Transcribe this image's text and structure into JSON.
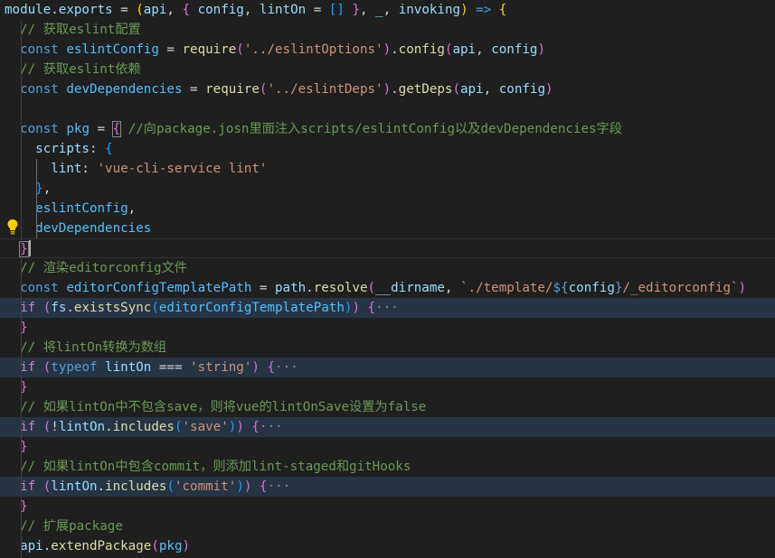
{
  "editor": {
    "lines": [
      {
        "id": "l1",
        "tokens": [
          {
            "t": "module",
            "k": "v"
          },
          {
            "t": ".",
            "k": "p"
          },
          {
            "t": "exports",
            "k": "v"
          },
          {
            "t": " = ",
            "k": "p"
          },
          {
            "t": "(",
            "k": "b1"
          },
          {
            "t": "api",
            "k": "v"
          },
          {
            "t": ", ",
            "k": "p"
          },
          {
            "t": "{",
            "k": "b2"
          },
          {
            "t": " config",
            "k": "v"
          },
          {
            "t": ", ",
            "k": "p"
          },
          {
            "t": "lintOn",
            "k": "v"
          },
          {
            "t": " = ",
            "k": "p"
          },
          {
            "t": "[]",
            "k": "b3"
          },
          {
            "t": " ",
            "k": "p"
          },
          {
            "t": "}",
            "k": "b2"
          },
          {
            "t": ", ",
            "k": "p"
          },
          {
            "t": "_",
            "k": "v"
          },
          {
            "t": ", ",
            "k": "p"
          },
          {
            "t": "invoking",
            "k": "v"
          },
          {
            "t": ")",
            "k": "b1"
          },
          {
            "t": " ",
            "k": "p"
          },
          {
            "t": "=>",
            "k": "kw"
          },
          {
            "t": " ",
            "k": "p"
          },
          {
            "t": "{",
            "k": "b1"
          }
        ]
      },
      {
        "id": "l2",
        "tokens": [
          {
            "t": "  ",
            "k": "p"
          },
          {
            "t": "// 获取eslint配置",
            "k": "cm"
          }
        ]
      },
      {
        "id": "l3",
        "tokens": [
          {
            "t": "  ",
            "k": "p"
          },
          {
            "t": "const",
            "k": "kw"
          },
          {
            "t": " ",
            "k": "p"
          },
          {
            "t": "eslintConfig",
            "k": "c"
          },
          {
            "t": " = ",
            "k": "p"
          },
          {
            "t": "require",
            "k": "f"
          },
          {
            "t": "(",
            "k": "b2"
          },
          {
            "t": "'../eslintOptions'",
            "k": "s"
          },
          {
            "t": ")",
            "k": "b2"
          },
          {
            "t": ".",
            "k": "p"
          },
          {
            "t": "config",
            "k": "f"
          },
          {
            "t": "(",
            "k": "b2"
          },
          {
            "t": "api",
            "k": "v"
          },
          {
            "t": ", ",
            "k": "p"
          },
          {
            "t": "config",
            "k": "v"
          },
          {
            "t": ")",
            "k": "b2"
          }
        ]
      },
      {
        "id": "l4",
        "tokens": [
          {
            "t": "  ",
            "k": "p"
          },
          {
            "t": "// 获取eslint依赖",
            "k": "cm"
          }
        ]
      },
      {
        "id": "l5",
        "tokens": [
          {
            "t": "  ",
            "k": "p"
          },
          {
            "t": "const",
            "k": "kw"
          },
          {
            "t": " ",
            "k": "p"
          },
          {
            "t": "devDependencies",
            "k": "c"
          },
          {
            "t": " = ",
            "k": "p"
          },
          {
            "t": "require",
            "k": "f"
          },
          {
            "t": "(",
            "k": "b2"
          },
          {
            "t": "'../eslintDeps'",
            "k": "s"
          },
          {
            "t": ")",
            "k": "b2"
          },
          {
            "t": ".",
            "k": "p"
          },
          {
            "t": "getDeps",
            "k": "f"
          },
          {
            "t": "(",
            "k": "b2"
          },
          {
            "t": "api",
            "k": "v"
          },
          {
            "t": ", ",
            "k": "p"
          },
          {
            "t": "config",
            "k": "v"
          },
          {
            "t": ")",
            "k": "b2"
          }
        ]
      },
      {
        "id": "l6",
        "tokens": []
      },
      {
        "id": "l7",
        "tokens": [
          {
            "t": "  ",
            "k": "p"
          },
          {
            "t": "const",
            "k": "kw"
          },
          {
            "t": " ",
            "k": "p"
          },
          {
            "t": "pkg",
            "k": "c"
          },
          {
            "t": " = ",
            "k": "p"
          },
          {
            "t": "{",
            "k": "b2",
            "m": true
          },
          {
            "t": " ",
            "k": "p"
          },
          {
            "t": "//向package.josn里面注入scripts/eslintConfig以及devDependencies字段",
            "k": "cm"
          }
        ]
      },
      {
        "id": "l8",
        "tokens": [
          {
            "t": "    ",
            "k": "p"
          },
          {
            "t": "scripts",
            "k": "v"
          },
          {
            "t": ": ",
            "k": "p"
          },
          {
            "t": "{",
            "k": "b3"
          }
        ]
      },
      {
        "id": "l9",
        "tokens": [
          {
            "t": "      ",
            "k": "p"
          },
          {
            "t": "lint",
            "k": "v"
          },
          {
            "t": ": ",
            "k": "p"
          },
          {
            "t": "'vue-cli-service lint'",
            "k": "s"
          }
        ]
      },
      {
        "id": "l10",
        "tokens": [
          {
            "t": "    ",
            "k": "p"
          },
          {
            "t": "}",
            "k": "b3"
          },
          {
            "t": ",",
            "k": "p"
          }
        ]
      },
      {
        "id": "l11",
        "tokens": [
          {
            "t": "    ",
            "k": "p"
          },
          {
            "t": "eslintConfig",
            "k": "c"
          },
          {
            "t": ",",
            "k": "p"
          }
        ]
      },
      {
        "id": "l12",
        "tokens": [
          {
            "t": "    ",
            "k": "p"
          },
          {
            "t": "devDependencies",
            "k": "c"
          }
        ]
      },
      {
        "id": "l13",
        "tokens": [
          {
            "t": "  ",
            "k": "p"
          },
          {
            "t": "}",
            "k": "b2",
            "m": true
          }
        ]
      },
      {
        "id": "l14",
        "tokens": [
          {
            "t": "  ",
            "k": "p"
          },
          {
            "t": "// 渲染editorconfig文件",
            "k": "cm"
          }
        ]
      },
      {
        "id": "l15",
        "tokens": [
          {
            "t": "  ",
            "k": "p"
          },
          {
            "t": "const",
            "k": "kw"
          },
          {
            "t": " ",
            "k": "p"
          },
          {
            "t": "editorConfigTemplatePath",
            "k": "c"
          },
          {
            "t": " = ",
            "k": "p"
          },
          {
            "t": "path",
            "k": "v"
          },
          {
            "t": ".",
            "k": "p"
          },
          {
            "t": "resolve",
            "k": "f"
          },
          {
            "t": "(",
            "k": "b2"
          },
          {
            "t": "__dirname",
            "k": "v"
          },
          {
            "t": ", ",
            "k": "p"
          },
          {
            "t": "`./template/",
            "k": "s"
          },
          {
            "t": "${",
            "k": "kw"
          },
          {
            "t": "config",
            "k": "v"
          },
          {
            "t": "}",
            "k": "kw"
          },
          {
            "t": "/_editorconfig`",
            "k": "s"
          },
          {
            "t": ")",
            "k": "b2"
          }
        ]
      },
      {
        "id": "l16",
        "folded": true,
        "tokens": [
          {
            "t": "  ",
            "k": "p"
          },
          {
            "t": "if",
            "k": "ctl"
          },
          {
            "t": " ",
            "k": "p"
          },
          {
            "t": "(",
            "k": "b2"
          },
          {
            "t": "fs",
            "k": "v"
          },
          {
            "t": ".",
            "k": "p"
          },
          {
            "t": "existsSync",
            "k": "f"
          },
          {
            "t": "(",
            "k": "b3"
          },
          {
            "t": "editorConfigTemplatePath",
            "k": "c"
          },
          {
            "t": ")",
            "k": "b3"
          },
          {
            "t": ")",
            "k": "b2"
          },
          {
            "t": " ",
            "k": "p"
          },
          {
            "t": "{",
            "k": "b2"
          },
          {
            "t": "···",
            "k": "fold"
          }
        ]
      },
      {
        "id": "l17",
        "tokens": [
          {
            "t": "  ",
            "k": "p"
          },
          {
            "t": "}",
            "k": "b2"
          }
        ]
      },
      {
        "id": "l18",
        "tokens": [
          {
            "t": "  ",
            "k": "p"
          },
          {
            "t": "// 将lintOn转换为数组",
            "k": "cm"
          }
        ]
      },
      {
        "id": "l19",
        "folded": true,
        "tokens": [
          {
            "t": "  ",
            "k": "p"
          },
          {
            "t": "if",
            "k": "ctl"
          },
          {
            "t": " ",
            "k": "p"
          },
          {
            "t": "(",
            "k": "b2"
          },
          {
            "t": "typeof",
            "k": "kw"
          },
          {
            "t": " ",
            "k": "p"
          },
          {
            "t": "lintOn",
            "k": "v"
          },
          {
            "t": " === ",
            "k": "p"
          },
          {
            "t": "'string'",
            "k": "s"
          },
          {
            "t": ")",
            "k": "b2"
          },
          {
            "t": " ",
            "k": "p"
          },
          {
            "t": "{",
            "k": "b2"
          },
          {
            "t": "···",
            "k": "fold"
          }
        ]
      },
      {
        "id": "l20",
        "tokens": [
          {
            "t": "  ",
            "k": "p"
          },
          {
            "t": "}",
            "k": "b2"
          }
        ]
      },
      {
        "id": "l21",
        "tokens": [
          {
            "t": "  ",
            "k": "p"
          },
          {
            "t": "// 如果lintOn中不包含save，则将vue的lintOnSave设置为false",
            "k": "cm"
          }
        ]
      },
      {
        "id": "l22",
        "folded": true,
        "tokens": [
          {
            "t": "  ",
            "k": "p"
          },
          {
            "t": "if",
            "k": "ctl"
          },
          {
            "t": " ",
            "k": "p"
          },
          {
            "t": "(",
            "k": "b2"
          },
          {
            "t": "!",
            "k": "p"
          },
          {
            "t": "lintOn",
            "k": "v"
          },
          {
            "t": ".",
            "k": "p"
          },
          {
            "t": "includes",
            "k": "f"
          },
          {
            "t": "(",
            "k": "b3"
          },
          {
            "t": "'save'",
            "k": "s"
          },
          {
            "t": ")",
            "k": "b3"
          },
          {
            "t": ")",
            "k": "b2"
          },
          {
            "t": " ",
            "k": "p"
          },
          {
            "t": "{",
            "k": "b2"
          },
          {
            "t": "···",
            "k": "fold"
          }
        ]
      },
      {
        "id": "l23",
        "tokens": [
          {
            "t": "  ",
            "k": "p"
          },
          {
            "t": "}",
            "k": "b2"
          }
        ]
      },
      {
        "id": "l24",
        "tokens": [
          {
            "t": "  ",
            "k": "p"
          },
          {
            "t": "// 如果lintOn中包含commit，则添加lint-staged和gitHooks",
            "k": "cm"
          }
        ]
      },
      {
        "id": "l25",
        "folded": true,
        "tokens": [
          {
            "t": "  ",
            "k": "p"
          },
          {
            "t": "if",
            "k": "ctl"
          },
          {
            "t": " ",
            "k": "p"
          },
          {
            "t": "(",
            "k": "b2"
          },
          {
            "t": "lintOn",
            "k": "v"
          },
          {
            "t": ".",
            "k": "p"
          },
          {
            "t": "includes",
            "k": "f"
          },
          {
            "t": "(",
            "k": "b3"
          },
          {
            "t": "'commit'",
            "k": "s"
          },
          {
            "t": ")",
            "k": "b3"
          },
          {
            "t": ")",
            "k": "b2"
          },
          {
            "t": " ",
            "k": "p"
          },
          {
            "t": "{",
            "k": "b2"
          },
          {
            "t": "···",
            "k": "fold"
          }
        ]
      },
      {
        "id": "l26",
        "tokens": [
          {
            "t": "  ",
            "k": "p"
          },
          {
            "t": "}",
            "k": "b2"
          }
        ]
      },
      {
        "id": "l27",
        "tokens": [
          {
            "t": "  ",
            "k": "p"
          },
          {
            "t": "// 扩展package",
            "k": "cm"
          }
        ]
      },
      {
        "id": "l28",
        "tokens": [
          {
            "t": "  ",
            "k": "p"
          },
          {
            "t": "api",
            "k": "v"
          },
          {
            "t": ".",
            "k": "p"
          },
          {
            "t": "extendPackage",
            "k": "f"
          },
          {
            "t": "(",
            "k": "b2"
          },
          {
            "t": "pkg",
            "k": "c"
          },
          {
            "t": ")",
            "k": "b2"
          }
        ]
      }
    ],
    "colors": {
      "background": "#1f1f1f",
      "folded_line": "#263444",
      "keyword": "#569cd6",
      "control": "#c586c0",
      "variable": "#9cdcfe",
      "constant": "#4fc1ff",
      "function": "#dcdcaa",
      "string": "#ce9178",
      "comment": "#6a9955",
      "bracket_1": "#ffd700",
      "bracket_2": "#da70d6",
      "bracket_3": "#179fff"
    },
    "icons": {
      "lightbulb": "lightbulb-icon"
    }
  }
}
